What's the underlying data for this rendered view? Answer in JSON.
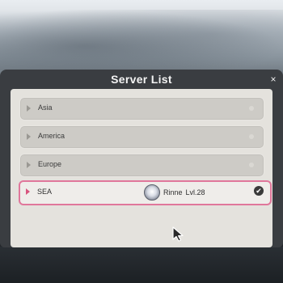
{
  "dialog": {
    "title": "Server List",
    "close_glyph": "×"
  },
  "servers": [
    {
      "label": "Asia",
      "selected": false
    },
    {
      "label": "America",
      "selected": false
    },
    {
      "label": "Europe",
      "selected": false
    },
    {
      "label": "SEA",
      "selected": true
    }
  ],
  "player": {
    "name": "Rinne",
    "level": "Lvl.28"
  },
  "colors": {
    "accent": "#e0779b",
    "panel": "#e4e2dd",
    "dialog": "#3a3d41"
  },
  "icons": {
    "close": "close-icon",
    "arrow": "play-arrow-icon",
    "check": "checkmark-icon",
    "cursor": "mouse-cursor-icon"
  }
}
